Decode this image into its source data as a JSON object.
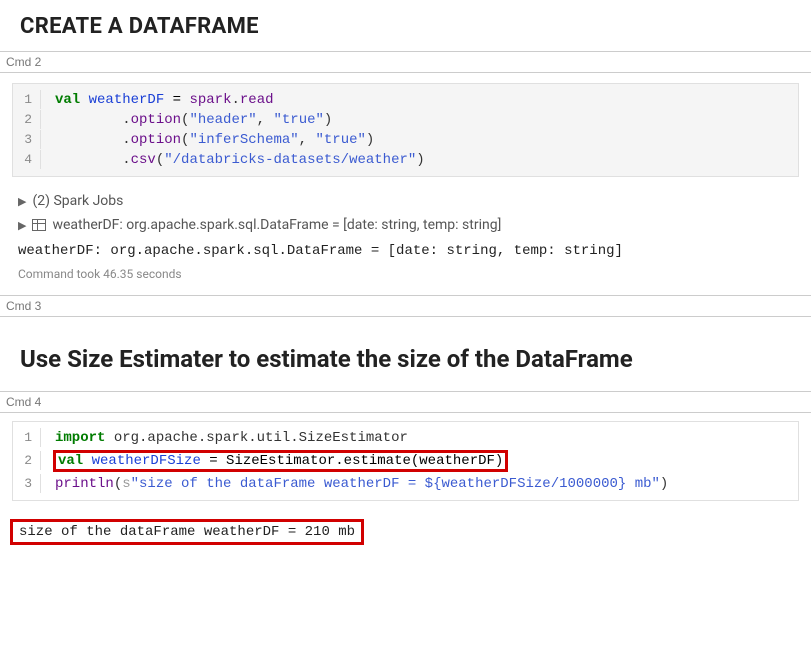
{
  "cell1": {
    "heading": "CREATE A DATAFRAME"
  },
  "cmd2": {
    "label": "Cmd 2",
    "lines": {
      "l1": {
        "n": "1",
        "kw": "val",
        "var": "weatherDF",
        "op": " = ",
        "id1": "spark",
        "dot1": ".",
        "id2": "read"
      },
      "l2": {
        "n": "2",
        "indent": "        ",
        "dot": ".",
        "id": "option",
        "lp": "(",
        "q1": "\"header\"",
        "comma": ", ",
        "q2": "\"true\"",
        "rp": ")"
      },
      "l3": {
        "n": "3",
        "indent": "        ",
        "dot": ".",
        "id": "option",
        "lp": "(",
        "q1": "\"inferSchema\"",
        "comma": ", ",
        "q2": "\"true\"",
        "rp": ")"
      },
      "l4": {
        "n": "4",
        "indent": "        ",
        "dot": ".",
        "id": "csv",
        "lp": "(",
        "q1": "\"/databricks-datasets/weather\"",
        "rp": ")"
      }
    },
    "spark_jobs": "(2) Spark Jobs",
    "schema_line": "weatherDF:  org.apache.spark.sql.DataFrame = [date: string, temp: string]",
    "repl_out": "weatherDF: org.apache.spark.sql.DataFrame = [date: string, temp: string]",
    "timing": "Command took 46.35 seconds"
  },
  "cmd3": {
    "label": "Cmd 3",
    "heading": "Use Size Estimater to estimate the size of the DataFrame"
  },
  "cmd4": {
    "label": "Cmd 4",
    "lines": {
      "l1": {
        "n": "1",
        "kw": "import",
        "rest": " org.apache.spark.util.SizeEstimator"
      },
      "l2": {
        "n": "2",
        "kw": "val",
        "var": "weatherDFSize",
        "op": " = SizeEstimator.estimate(weatherDF)"
      },
      "l3": {
        "n": "3",
        "id": "println",
        "lp": "(",
        "s": "s",
        "q": "\"size of the dataFrame weatherDF = ${weatherDFSize/1000000} mb\"",
        "rp": ")"
      }
    },
    "output": "size of the dataFrame weatherDF = 210 mb"
  }
}
